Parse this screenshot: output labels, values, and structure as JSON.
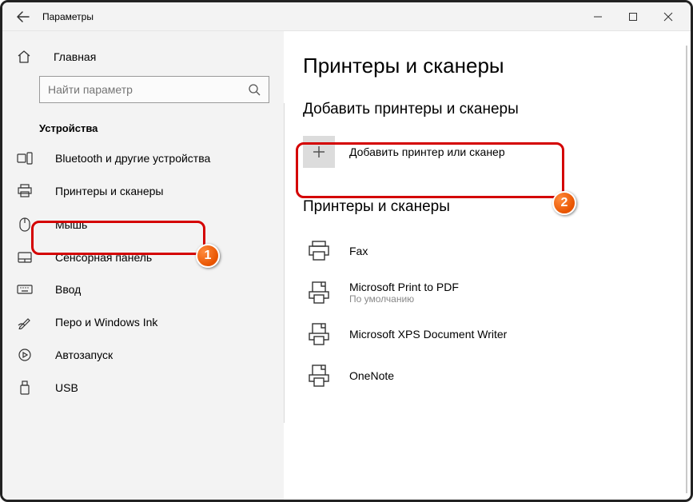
{
  "titlebar": {
    "title": "Параметры"
  },
  "sidebar": {
    "home": "Главная",
    "search_placeholder": "Найти параметр",
    "section": "Устройства",
    "items": [
      {
        "label": "Bluetooth и другие устройства"
      },
      {
        "label": "Принтеры и сканеры"
      },
      {
        "label": "Мышь"
      },
      {
        "label": "Сенсорная панель"
      },
      {
        "label": "Ввод"
      },
      {
        "label": "Перо и Windows Ink"
      },
      {
        "label": "Автозапуск"
      },
      {
        "label": "USB"
      }
    ]
  },
  "main": {
    "title": "Принтеры и сканеры",
    "add_section": "Добавить принтеры и сканеры",
    "add_button": "Добавить принтер или сканер",
    "list_section": "Принтеры и сканеры",
    "printers": [
      {
        "name": "Fax",
        "sub": ""
      },
      {
        "name": "Microsoft Print to PDF",
        "sub": "По умолчанию"
      },
      {
        "name": "Microsoft XPS Document Writer",
        "sub": ""
      },
      {
        "name": "OneNote",
        "sub": ""
      }
    ]
  },
  "annotations": {
    "b1": "1",
    "b2": "2"
  }
}
